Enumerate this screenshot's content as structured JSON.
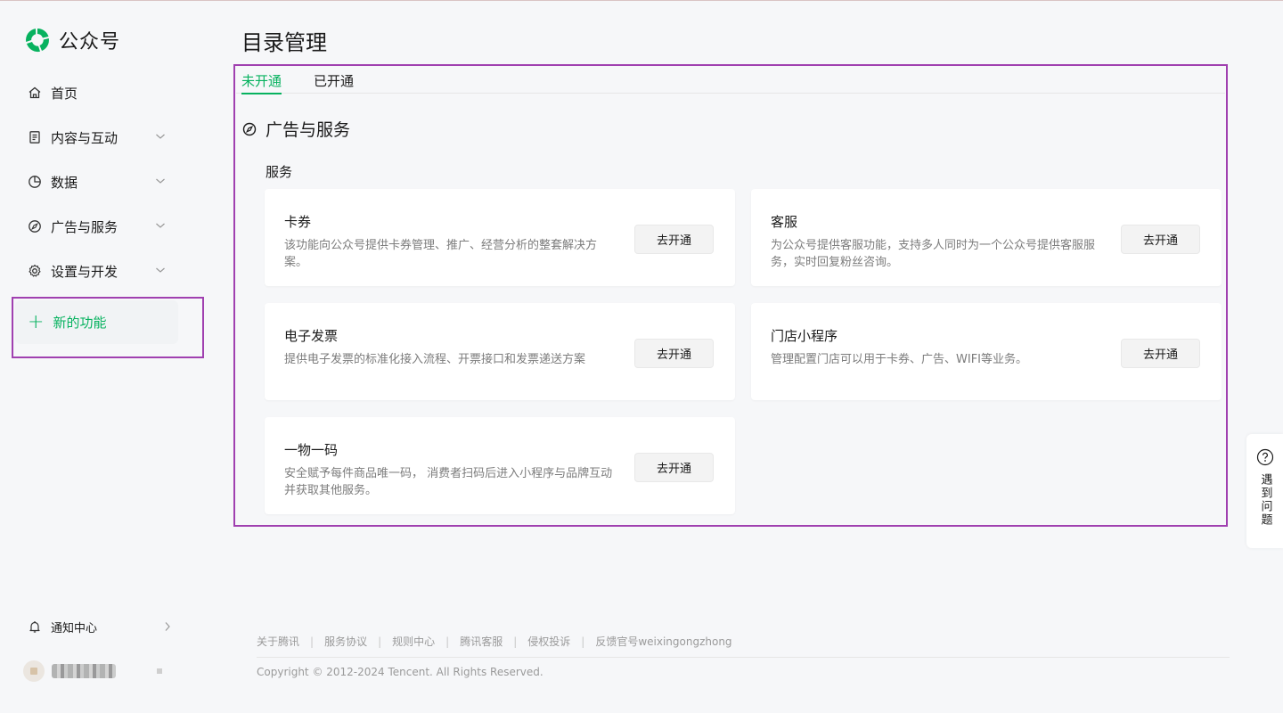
{
  "app": {
    "name": "公众号"
  },
  "sidebar": {
    "items": [
      {
        "label": "首页",
        "icon": "home-icon"
      },
      {
        "label": "内容与互动",
        "icon": "document-icon"
      },
      {
        "label": "数据",
        "icon": "pie-chart-icon"
      },
      {
        "label": "广告与服务",
        "icon": "compass-icon"
      },
      {
        "label": "设置与开发",
        "icon": "gear-icon"
      }
    ],
    "new_feature": {
      "label": "新的功能",
      "icon": "plus-icon"
    },
    "notify_label": "通知中心"
  },
  "page": {
    "title": "目录管理"
  },
  "tabs": [
    {
      "label": "未开通",
      "active": true
    },
    {
      "label": "已开通",
      "active": false
    }
  ],
  "section": {
    "title": "广告与服务",
    "subsection": "服务"
  },
  "cards": [
    {
      "title": "卡券",
      "desc": "该功能向公众号提供卡券管理、推广、经营分析的整套解决方案。",
      "button": "去开通"
    },
    {
      "title": "客服",
      "desc": "为公众号提供客服功能，支持多人同时为一个公众号提供客服服务，实时回复粉丝咨询。",
      "button": "去开通"
    },
    {
      "title": "电子发票",
      "desc": "提供电子发票的标准化接入流程、开票接口和发票递送方案",
      "button": "去开通"
    },
    {
      "title": "门店小程序",
      "desc": "管理配置门店可以用于卡券、广告、WIFI等业务。",
      "button": "去开通"
    },
    {
      "title": "一物一码",
      "desc": "安全赋予每件商品唯一码， 消费者扫码后进入小程序与品牌互动并获取其他服务。",
      "button": "去开通"
    }
  ],
  "footer": {
    "links": [
      "关于腾讯",
      "服务协议",
      "规则中心",
      "腾讯客服",
      "侵权投诉",
      "反馈官号weixingongzhong"
    ],
    "copyright": "Copyright © 2012-2024 Tencent. All Rights Reserved."
  },
  "help": {
    "label": "遇到问题",
    "icon": "question-icon"
  },
  "colors": {
    "brand_green": "#07b25f",
    "highlight": "#a040b0"
  }
}
